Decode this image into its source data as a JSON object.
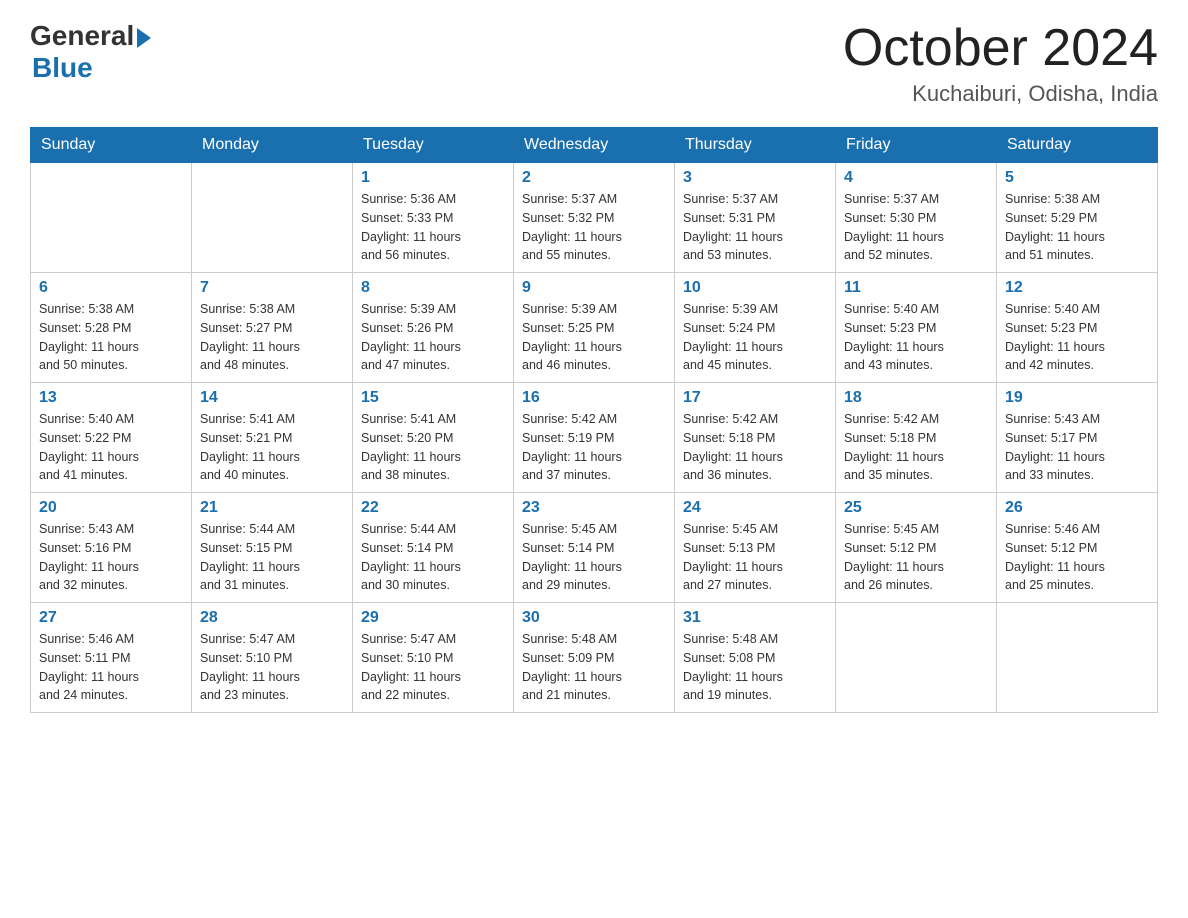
{
  "header": {
    "logo_general": "General",
    "logo_blue": "Blue",
    "month_title": "October 2024",
    "location": "Kuchaiburi, Odisha, India"
  },
  "days_of_week": [
    "Sunday",
    "Monday",
    "Tuesday",
    "Wednesday",
    "Thursday",
    "Friday",
    "Saturday"
  ],
  "weeks": [
    [
      {
        "day": "",
        "info": ""
      },
      {
        "day": "",
        "info": ""
      },
      {
        "day": "1",
        "info": "Sunrise: 5:36 AM\nSunset: 5:33 PM\nDaylight: 11 hours\nand 56 minutes."
      },
      {
        "day": "2",
        "info": "Sunrise: 5:37 AM\nSunset: 5:32 PM\nDaylight: 11 hours\nand 55 minutes."
      },
      {
        "day": "3",
        "info": "Sunrise: 5:37 AM\nSunset: 5:31 PM\nDaylight: 11 hours\nand 53 minutes."
      },
      {
        "day": "4",
        "info": "Sunrise: 5:37 AM\nSunset: 5:30 PM\nDaylight: 11 hours\nand 52 minutes."
      },
      {
        "day": "5",
        "info": "Sunrise: 5:38 AM\nSunset: 5:29 PM\nDaylight: 11 hours\nand 51 minutes."
      }
    ],
    [
      {
        "day": "6",
        "info": "Sunrise: 5:38 AM\nSunset: 5:28 PM\nDaylight: 11 hours\nand 50 minutes."
      },
      {
        "day": "7",
        "info": "Sunrise: 5:38 AM\nSunset: 5:27 PM\nDaylight: 11 hours\nand 48 minutes."
      },
      {
        "day": "8",
        "info": "Sunrise: 5:39 AM\nSunset: 5:26 PM\nDaylight: 11 hours\nand 47 minutes."
      },
      {
        "day": "9",
        "info": "Sunrise: 5:39 AM\nSunset: 5:25 PM\nDaylight: 11 hours\nand 46 minutes."
      },
      {
        "day": "10",
        "info": "Sunrise: 5:39 AM\nSunset: 5:24 PM\nDaylight: 11 hours\nand 45 minutes."
      },
      {
        "day": "11",
        "info": "Sunrise: 5:40 AM\nSunset: 5:23 PM\nDaylight: 11 hours\nand 43 minutes."
      },
      {
        "day": "12",
        "info": "Sunrise: 5:40 AM\nSunset: 5:23 PM\nDaylight: 11 hours\nand 42 minutes."
      }
    ],
    [
      {
        "day": "13",
        "info": "Sunrise: 5:40 AM\nSunset: 5:22 PM\nDaylight: 11 hours\nand 41 minutes."
      },
      {
        "day": "14",
        "info": "Sunrise: 5:41 AM\nSunset: 5:21 PM\nDaylight: 11 hours\nand 40 minutes."
      },
      {
        "day": "15",
        "info": "Sunrise: 5:41 AM\nSunset: 5:20 PM\nDaylight: 11 hours\nand 38 minutes."
      },
      {
        "day": "16",
        "info": "Sunrise: 5:42 AM\nSunset: 5:19 PM\nDaylight: 11 hours\nand 37 minutes."
      },
      {
        "day": "17",
        "info": "Sunrise: 5:42 AM\nSunset: 5:18 PM\nDaylight: 11 hours\nand 36 minutes."
      },
      {
        "day": "18",
        "info": "Sunrise: 5:42 AM\nSunset: 5:18 PM\nDaylight: 11 hours\nand 35 minutes."
      },
      {
        "day": "19",
        "info": "Sunrise: 5:43 AM\nSunset: 5:17 PM\nDaylight: 11 hours\nand 33 minutes."
      }
    ],
    [
      {
        "day": "20",
        "info": "Sunrise: 5:43 AM\nSunset: 5:16 PM\nDaylight: 11 hours\nand 32 minutes."
      },
      {
        "day": "21",
        "info": "Sunrise: 5:44 AM\nSunset: 5:15 PM\nDaylight: 11 hours\nand 31 minutes."
      },
      {
        "day": "22",
        "info": "Sunrise: 5:44 AM\nSunset: 5:14 PM\nDaylight: 11 hours\nand 30 minutes."
      },
      {
        "day": "23",
        "info": "Sunrise: 5:45 AM\nSunset: 5:14 PM\nDaylight: 11 hours\nand 29 minutes."
      },
      {
        "day": "24",
        "info": "Sunrise: 5:45 AM\nSunset: 5:13 PM\nDaylight: 11 hours\nand 27 minutes."
      },
      {
        "day": "25",
        "info": "Sunrise: 5:45 AM\nSunset: 5:12 PM\nDaylight: 11 hours\nand 26 minutes."
      },
      {
        "day": "26",
        "info": "Sunrise: 5:46 AM\nSunset: 5:12 PM\nDaylight: 11 hours\nand 25 minutes."
      }
    ],
    [
      {
        "day": "27",
        "info": "Sunrise: 5:46 AM\nSunset: 5:11 PM\nDaylight: 11 hours\nand 24 minutes."
      },
      {
        "day": "28",
        "info": "Sunrise: 5:47 AM\nSunset: 5:10 PM\nDaylight: 11 hours\nand 23 minutes."
      },
      {
        "day": "29",
        "info": "Sunrise: 5:47 AM\nSunset: 5:10 PM\nDaylight: 11 hours\nand 22 minutes."
      },
      {
        "day": "30",
        "info": "Sunrise: 5:48 AM\nSunset: 5:09 PM\nDaylight: 11 hours\nand 21 minutes."
      },
      {
        "day": "31",
        "info": "Sunrise: 5:48 AM\nSunset: 5:08 PM\nDaylight: 11 hours\nand 19 minutes."
      },
      {
        "day": "",
        "info": ""
      },
      {
        "day": "",
        "info": ""
      }
    ]
  ]
}
